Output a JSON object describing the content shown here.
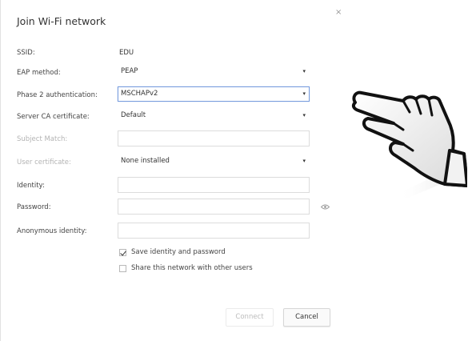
{
  "dialog": {
    "title": "Join Wi-Fi network",
    "close_label": "×"
  },
  "fields": {
    "ssid": {
      "label": "SSID:",
      "value": "EDU"
    },
    "eap_method": {
      "label": "EAP method:",
      "value": "PEAP"
    },
    "phase2": {
      "label": "Phase 2 authentication:",
      "value": "MSCHAPv2"
    },
    "server_ca": {
      "label": "Server CA certificate:",
      "value": "Default"
    },
    "subject_match": {
      "label": "Subject Match:",
      "value": ""
    },
    "user_cert": {
      "label": "User certificate:",
      "value": "None installed"
    },
    "identity": {
      "label": "Identity:",
      "value": ""
    },
    "password": {
      "label": "Password:",
      "value": ""
    },
    "anon_identity": {
      "label": "Anonymous identity:",
      "value": ""
    }
  },
  "checkboxes": {
    "save_identity": {
      "label": "Save identity and password",
      "checked": true
    },
    "share_network": {
      "label": "Share this network with other users",
      "checked": false
    }
  },
  "buttons": {
    "connect": "Connect",
    "cancel": "Cancel"
  },
  "icons": {
    "caret": "▾",
    "eye": "eye-icon",
    "pointer": "hand-pointer-icon"
  },
  "colors": {
    "focus_border": "#7a9ede"
  }
}
